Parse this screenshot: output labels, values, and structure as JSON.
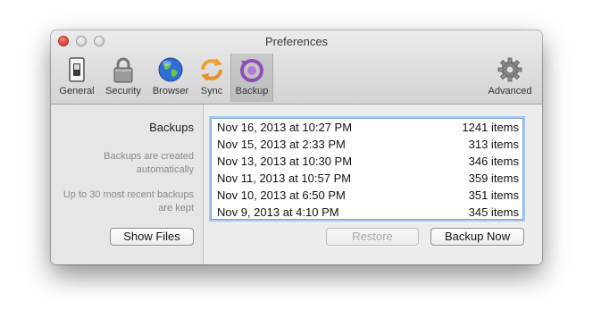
{
  "window": {
    "title": "Preferences"
  },
  "toolbar": {
    "items": [
      {
        "label": "General",
        "icon": "switch-icon"
      },
      {
        "label": "Security",
        "icon": "padlock-icon"
      },
      {
        "label": "Browser",
        "icon": "globe-icon"
      },
      {
        "label": "Sync",
        "icon": "sync-icon"
      },
      {
        "label": "Backup",
        "icon": "backup-icon",
        "selected": true
      },
      {
        "label": "Advanced",
        "icon": "gear-icon"
      }
    ]
  },
  "sidebar": {
    "heading": "Backups",
    "note1": "Backups are created automatically",
    "note2": "Up to 30 most recent backups are kept",
    "show_files_label": "Show Files"
  },
  "backups": [
    {
      "date": "Nov 16, 2013 at 10:27 PM",
      "count": "1241 items"
    },
    {
      "date": "Nov 15, 2013 at 2:33 PM",
      "count": "313 items"
    },
    {
      "date": "Nov 13, 2013 at 10:30 PM",
      "count": "346 items"
    },
    {
      "date": "Nov 11, 2013 at 10:57 PM",
      "count": "359 items"
    },
    {
      "date": "Nov 10, 2013 at 6:50 PM",
      "count": "351 items"
    },
    {
      "date": "Nov 9, 2013 at 4:10 PM",
      "count": "345 items"
    }
  ],
  "actions": {
    "restore_label": "Restore",
    "backup_now_label": "Backup Now"
  },
  "colors": {
    "accent_blue": "#7aa5d8",
    "backup_purple": "#8c4fb8",
    "sync_orange": "#f0a030"
  }
}
